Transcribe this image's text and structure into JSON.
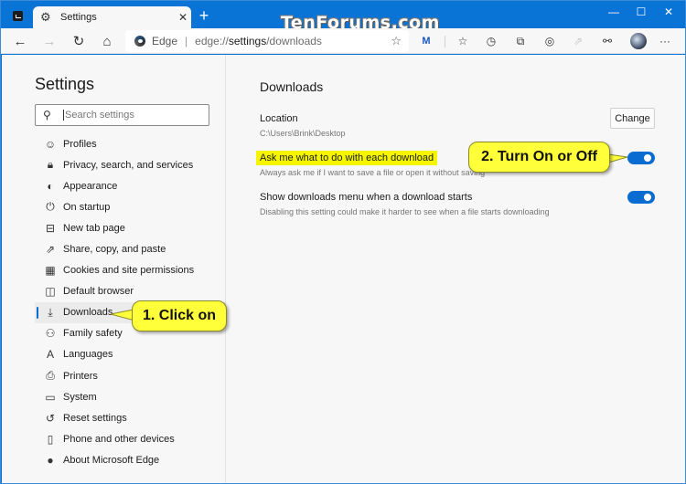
{
  "browser": {
    "tab": {
      "title": "Settings",
      "icon": "gear-icon"
    },
    "watermark": "TenForums.com",
    "window_controls": {
      "minimize": "—",
      "maximize": "☐",
      "close": "✕"
    },
    "address": {
      "site_label": "Edge",
      "separator": "|",
      "url_prefix": "edge://",
      "url_bold": "settings",
      "url_suffix": "/downloads"
    },
    "toolbar_icons": [
      "favorites-add-icon",
      "malwarebytes-icon",
      "favorites-icon",
      "history-icon",
      "collections-icon",
      "web-capture-icon",
      "share-icon",
      "extensions-icon",
      "profile-avatar",
      "more-icon"
    ]
  },
  "sidebar": {
    "title": "Settings",
    "search_placeholder": "Search settings",
    "items": [
      {
        "label": "Profiles",
        "icon": "profile-icon"
      },
      {
        "label": "Privacy, search, and services",
        "icon": "lock-icon"
      },
      {
        "label": "Appearance",
        "icon": "palette-icon"
      },
      {
        "label": "On startup",
        "icon": "power-icon"
      },
      {
        "label": "New tab page",
        "icon": "new-tab-icon"
      },
      {
        "label": "Share, copy, and paste",
        "icon": "share-icon"
      },
      {
        "label": "Cookies and site permissions",
        "icon": "cookies-icon"
      },
      {
        "label": "Default browser",
        "icon": "default-browser-icon"
      },
      {
        "label": "Downloads",
        "icon": "download-icon",
        "selected": true
      },
      {
        "label": "Family safety",
        "icon": "family-icon"
      },
      {
        "label": "Languages",
        "icon": "languages-icon"
      },
      {
        "label": "Printers",
        "icon": "printer-icon"
      },
      {
        "label": "System",
        "icon": "laptop-icon"
      },
      {
        "label": "Reset settings",
        "icon": "reset-icon"
      },
      {
        "label": "Phone and other devices",
        "icon": "phone-icon"
      },
      {
        "label": "About Microsoft Edge",
        "icon": "edge-logo-icon"
      }
    ]
  },
  "main": {
    "title": "Downloads",
    "location": {
      "label": "Location",
      "path": "C:\\Users\\Brink\\Desktop",
      "button": "Change"
    },
    "ask": {
      "label": "Ask me what to do with each download",
      "description": "Always ask me if I want to save a file or open it without saving",
      "enabled": true
    },
    "show_menu": {
      "label": "Show downloads menu when a download starts",
      "description": "Disabling this setting could make it harder to see when a file starts downloading",
      "enabled": true
    }
  },
  "callouts": {
    "step1": "1. Click on",
    "step2": "2. Turn On or Off"
  },
  "colors": {
    "accent": "#0a6cd0",
    "titlebar": "#0a74d6",
    "highlight": "#f5f500",
    "callout": "#ffff3a"
  }
}
